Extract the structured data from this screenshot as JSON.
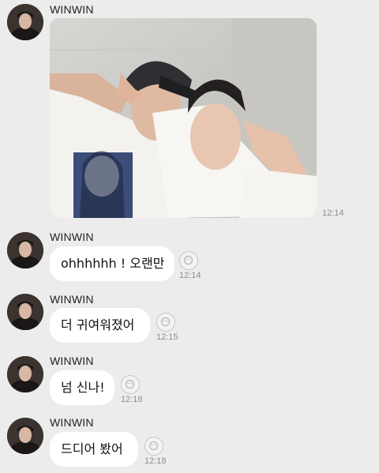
{
  "chat": {
    "messages": [
      {
        "sender": "WINWIN",
        "type": "photo",
        "time": "12:14",
        "photo_icon": "selfie-photo"
      },
      {
        "sender": "WINWIN",
        "type": "text",
        "text": "ohhhhhh ! 오랜만",
        "time": "12:14"
      },
      {
        "sender": "WINWIN",
        "type": "text",
        "text": "더 귀여워졌어",
        "time": "12:15"
      },
      {
        "sender": "WINWIN",
        "type": "text",
        "text": "넘 신나!",
        "time": "12:18"
      },
      {
        "sender": "WINWIN",
        "type": "text",
        "text": "드디어 봤어",
        "time": "12:18"
      }
    ],
    "reaction_icon": "add-reaction-icon",
    "avatar_icon": "profile-avatar"
  },
  "colors": {
    "background": "#ececec",
    "bubble": "#ffffff",
    "time_text": "#8e8e8e"
  }
}
